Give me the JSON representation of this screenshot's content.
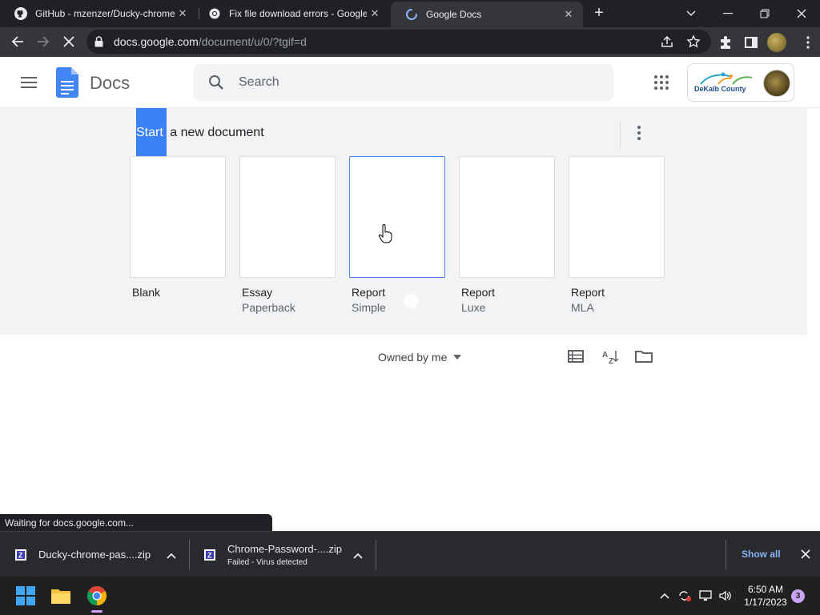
{
  "browser": {
    "tabs": [
      {
        "title": "GitHub - mzenzer/Ducky-chrome-",
        "favicon": "github-icon"
      },
      {
        "title": "Fix file download errors - Google",
        "favicon": "chrome-help-icon"
      },
      {
        "title": "Google Docs",
        "favicon": "loading-spinner-icon",
        "active": true
      }
    ],
    "close_glyph": "✕",
    "new_tab_glyph": "+",
    "address": {
      "host": "docs.google.com",
      "path": "/document/u/0/?tgif=d"
    },
    "status_text": "Waiting for docs.google.com..."
  },
  "docs": {
    "app_name": "Docs",
    "search_placeholder": "Search",
    "account_org": "DeKalb County",
    "gallery": {
      "title_highlight": "Start",
      "title_rest": " a new document",
      "templates": [
        {
          "name": "Blank",
          "sub": ""
        },
        {
          "name": "Essay",
          "sub": "Paperback"
        },
        {
          "name": "Report",
          "sub": "Simple"
        },
        {
          "name": "Report",
          "sub": "Luxe"
        },
        {
          "name": "Report",
          "sub": "MLA"
        }
      ]
    },
    "owner_filter": "Owned by me"
  },
  "downloads": {
    "items": [
      {
        "filename": "Ducky-chrome-pas....zip",
        "status": ""
      },
      {
        "filename": "Chrome-Password-....zip",
        "status": "Failed - Virus detected"
      }
    ],
    "show_all": "Show all"
  },
  "taskbar": {
    "time": "6:50 AM",
    "date": "1/17/2023",
    "notification_count": "3"
  },
  "colors": {
    "accent": "#4285f4",
    "highlight": "#3b82f6",
    "show_all_link": "#8ab4f8"
  }
}
